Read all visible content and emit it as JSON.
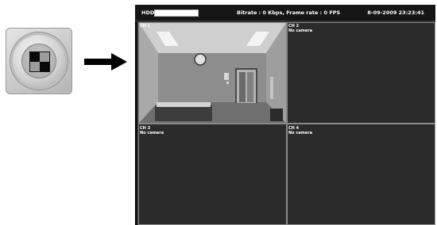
{
  "icon": {
    "name": "quad-view-icon"
  },
  "arrow": {
    "name": "right-arrow-icon"
  },
  "status_bar": {
    "hdd_label": "HDD",
    "hdd_usage_fraction": 1.0,
    "status_text": "Bitrate : 0 Kbps, Frame rate : 0 FPS",
    "datetime": "8-09-2009 23:23:41"
  },
  "channels": [
    {
      "label": "CH 1",
      "message": ""
    },
    {
      "label": "CH 2",
      "message": "No camera"
    },
    {
      "label": "CH 3",
      "message": "No camera"
    },
    {
      "label": "CH 4",
      "message": "No camera"
    }
  ],
  "colors": {
    "monitor_background": "#2b2b2b",
    "grid_line": "#8a8a8a",
    "text": "#ffffff"
  }
}
